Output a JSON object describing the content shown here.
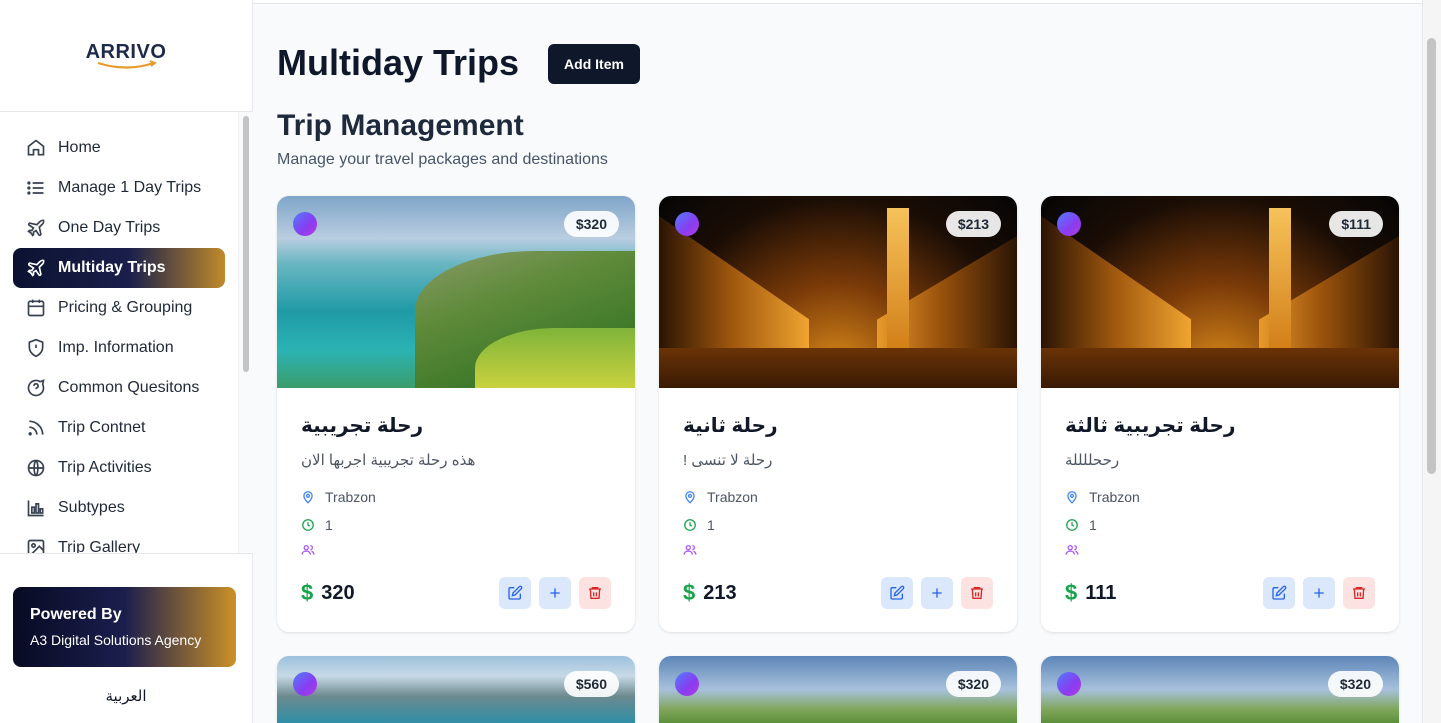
{
  "logo": {
    "text": "ARRIVO"
  },
  "sidebar": {
    "items": [
      {
        "label": "Home",
        "icon": "home-icon"
      },
      {
        "label": "Manage 1 Day Trips",
        "icon": "list-icon"
      },
      {
        "label": "One Day Trips",
        "icon": "plane-icon"
      },
      {
        "label": "Multiday Trips",
        "icon": "plane-icon",
        "active": true
      },
      {
        "label": "Pricing & Grouping",
        "icon": "calendar-icon"
      },
      {
        "label": "Imp. Information",
        "icon": "shield-icon"
      },
      {
        "label": "Common Quesitons",
        "icon": "question-bubble-icon"
      },
      {
        "label": "Trip Contnet",
        "icon": "rss-icon"
      },
      {
        "label": "Trip Activities",
        "icon": "globe-icon"
      },
      {
        "label": "Subtypes",
        "icon": "bar-chart-icon"
      },
      {
        "label": "Trip Gallery",
        "icon": "image-icon"
      }
    ],
    "powered_by": {
      "title": "Powered By",
      "agency": "A3 Digital Solutions Agency"
    },
    "language_toggle": "العربية"
  },
  "main": {
    "page_title": "Multiday Trips",
    "add_button": "Add Item",
    "section_title": "Trip Management",
    "section_subtitle": "Manage your travel packages and destinations",
    "cards": [
      {
        "badge": "$320",
        "title": "رحلة تجريبية",
        "description": "هذه رحلة تجريبية اجربها الان",
        "location": "Trabzon",
        "duration": "1",
        "price_symbol": "$",
        "price": "320"
      },
      {
        "badge": "$213",
        "title": "رحلة ثانية",
        "description": "رحلة لا تنسى !",
        "location": "Trabzon",
        "duration": "1",
        "price_symbol": "$",
        "price": "213"
      },
      {
        "badge": "$111",
        "title": "رحلة تجريبية ثالثة",
        "description": "رححللللة",
        "location": "Trabzon",
        "duration": "1",
        "price_symbol": "$",
        "price": "111"
      },
      {
        "badge": "$560"
      },
      {
        "badge": "$320"
      },
      {
        "badge": "$320"
      }
    ]
  },
  "colors": {
    "accent_dark": "#0f172a",
    "active_gradient_start": "#0b1230",
    "active_gradient_end": "#c08a2a",
    "price_green": "#16a34a",
    "edit_blue": "#2563eb",
    "delete_red": "#dc2626"
  }
}
